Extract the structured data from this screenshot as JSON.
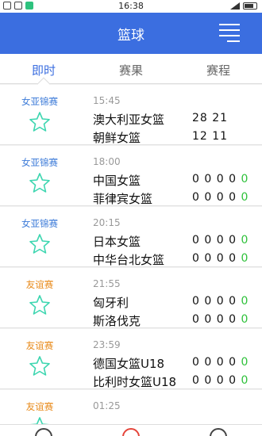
{
  "statusbar": {
    "time": "16:38"
  },
  "header": {
    "title": "篮球"
  },
  "tabs": [
    {
      "label": "即时",
      "active": true
    },
    {
      "label": "赛果",
      "active": false
    },
    {
      "label": "赛程",
      "active": false
    }
  ],
  "colors": {
    "accent": "#3b6ee0",
    "league_blue": "#3b7ad8",
    "league_orange": "#e88a1a",
    "score_green": "#2ec13a",
    "star": "#3dd6b0"
  },
  "matches": [
    {
      "league": "女亚锦赛",
      "league_color": "blue",
      "time": "15:45",
      "team1": "澳大利亚女篮",
      "team2": "朝鲜女篮",
      "score1": "28 21",
      "score2": "12 11",
      "last1": "",
      "last2": ""
    },
    {
      "league": "女亚锦赛",
      "league_color": "blue",
      "time": "18:00",
      "team1": "中国女篮",
      "team2": "菲律宾女篮",
      "score1": "0 0 0 0",
      "score2": "0 0 0 0",
      "last1": "0",
      "last2": "0"
    },
    {
      "league": "女亚锦赛",
      "league_color": "blue",
      "time": "20:15",
      "team1": "日本女篮",
      "team2": "中华台北女篮",
      "score1": "0 0 0 0",
      "score2": "0 0 0 0",
      "last1": "0",
      "last2": "0"
    },
    {
      "league": "友谊赛",
      "league_color": "orange",
      "time": "21:55",
      "team1": "匈牙利",
      "team2": "斯洛伐克",
      "score1": "0 0 0 0",
      "score2": "0 0 0 0",
      "last1": "0",
      "last2": "0"
    },
    {
      "league": "友谊赛",
      "league_color": "orange",
      "time": "23:59",
      "team1": "德国女篮U18",
      "team2": "比利时女篮U18",
      "score1": "0 0 0 0",
      "score2": "0 0 0 0",
      "last1": "0",
      "last2": "0"
    },
    {
      "league": "友谊赛",
      "league_color": "orange",
      "time": "01:25",
      "team1": "",
      "team2": "",
      "score1": "",
      "score2": "",
      "last1": "",
      "last2": ""
    }
  ],
  "bottom_nav": [
    {
      "icon": "list-icon"
    },
    {
      "icon": "compass-icon"
    },
    {
      "icon": "document-icon"
    }
  ]
}
